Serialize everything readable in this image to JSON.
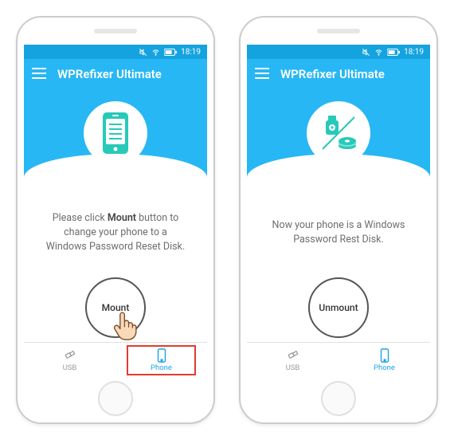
{
  "status": {
    "time": "18:19"
  },
  "header": {
    "title": "WPRefixer Ultimate"
  },
  "left": {
    "msg_pre": "Please click ",
    "msg_bold": "Mount",
    "msg_post": " button to change your phone to a Windows Password Reset Disk.",
    "button_label": "Mount"
  },
  "right": {
    "msg": "Now your phone is a Windows Password Rest Disk.",
    "button_label": "Unmount"
  },
  "tabs": {
    "usb": "USB",
    "phone": "Phone"
  }
}
